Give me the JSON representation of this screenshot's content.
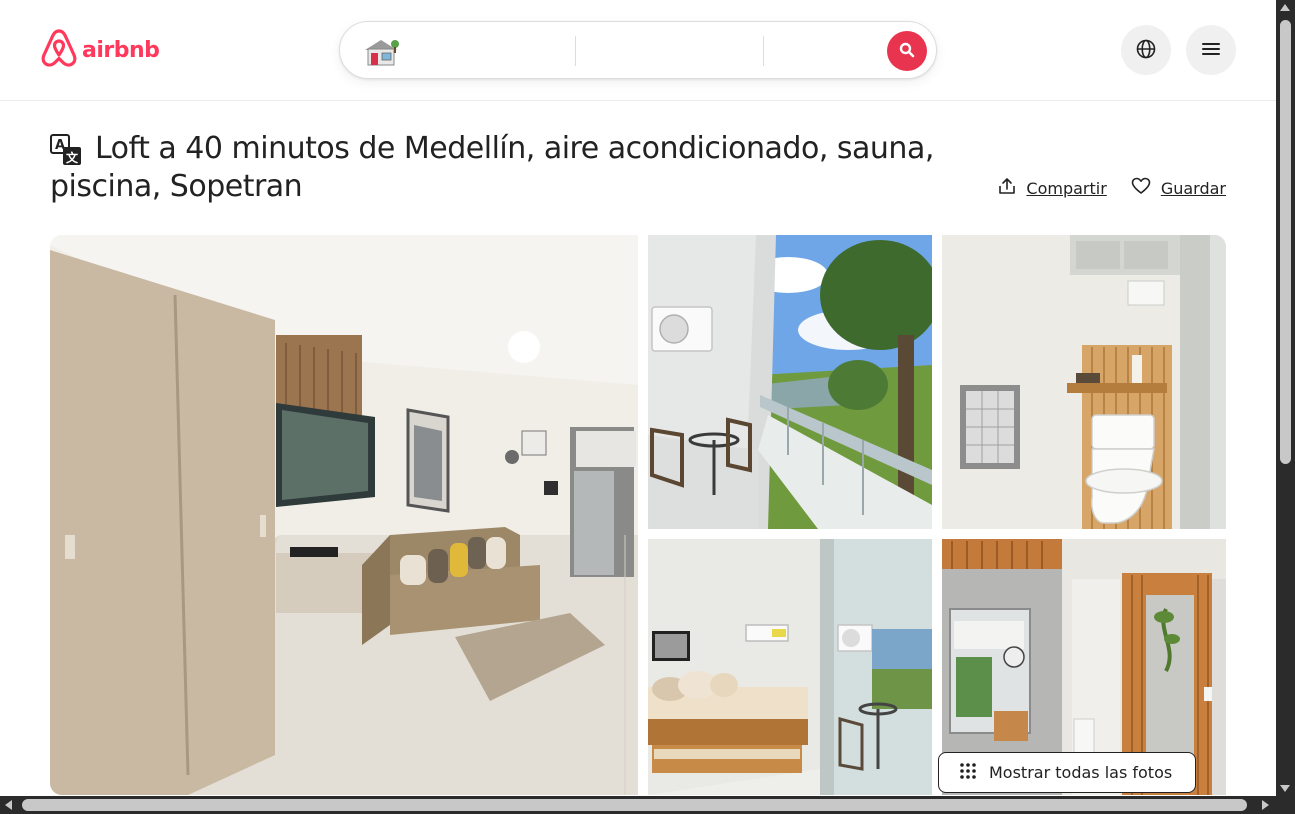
{
  "brand": {
    "name": "airbnb",
    "color": "#ff385c",
    "logo_icon": "airbnb-belo-icon"
  },
  "search": {
    "listing_icon": "house-icon",
    "where_value": "",
    "when_value": "",
    "who_value": "",
    "button_icon": "search-icon",
    "button_color": "#e8344e"
  },
  "header_buttons": {
    "language_icon": "globe-icon",
    "menu_icon": "hamburger-menu-icon"
  },
  "listing": {
    "title": "Loft a 40 minutos de Medellín, aire acondicionado, sauna, piscina, Sopetran",
    "translate_icon": "translate-icon",
    "share_label": "Compartir",
    "share_icon": "share-icon",
    "save_label": "Guardar",
    "save_icon": "heart-icon"
  },
  "gallery": {
    "photos": [
      "Living room with wardrobe, TV and beige sofa",
      "Balcony with table, chairs and mountain view",
      "Bathroom with toilet and wooden slat wall",
      "Bedroom with trundle bed and balcony",
      "Hallway with mirror, clock and wooden slat divider"
    ],
    "show_all_label": "Mostrar todas las fotos",
    "show_all_icon": "grid-dots-icon"
  },
  "colors": {
    "text": "#222222",
    "border": "#dddddd",
    "accent": "#ff385c"
  }
}
